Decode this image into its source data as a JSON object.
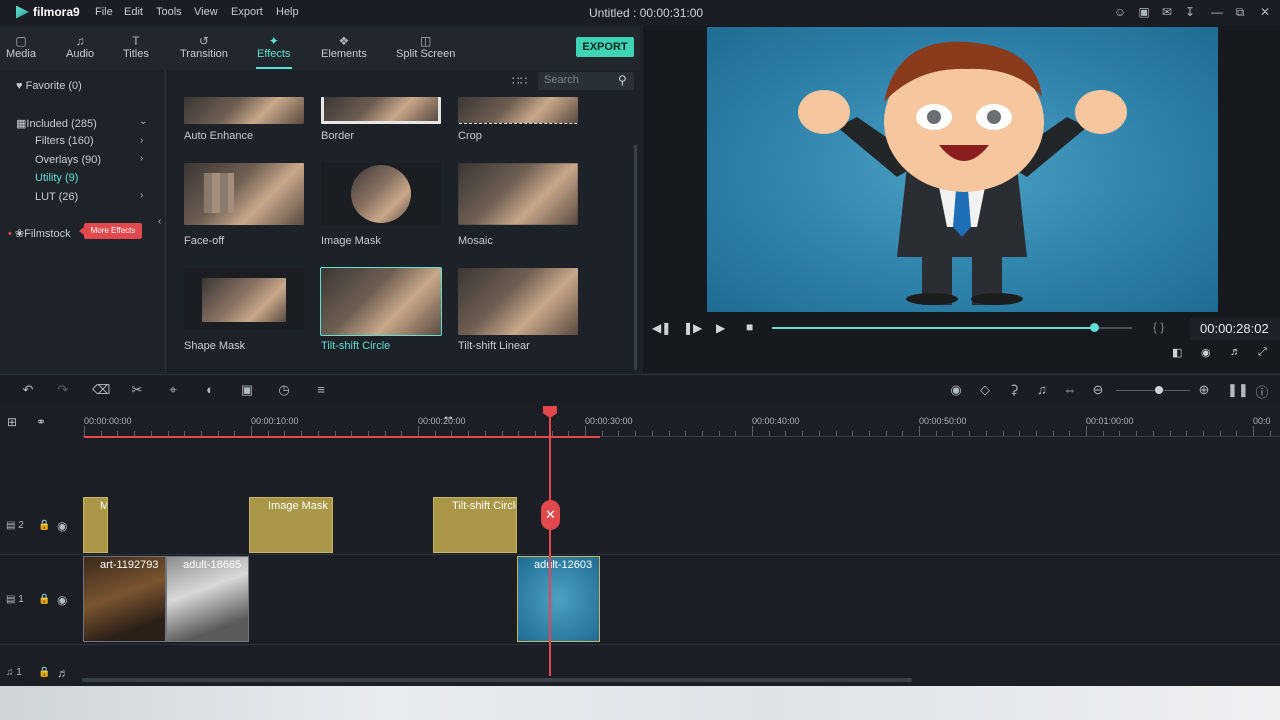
{
  "app": {
    "logo_text": "filmora9",
    "doc_title": "Untitled : 00:00:31:00",
    "menu": [
      "File",
      "Edit",
      "Tools",
      "View",
      "Export",
      "Help"
    ]
  },
  "tabs": [
    {
      "label": "Media",
      "icon": "folder-icon"
    },
    {
      "label": "Audio",
      "icon": "music-icon"
    },
    {
      "label": "Titles",
      "icon": "text-icon"
    },
    {
      "label": "Transition",
      "icon": "transition-icon"
    },
    {
      "label": "Effects",
      "icon": "effects-icon"
    },
    {
      "label": "Elements",
      "icon": "elements-icon"
    },
    {
      "label": "Split Screen",
      "icon": "split-screen-icon"
    }
  ],
  "export_label": "EXPORT",
  "sidebar": {
    "favorite": "Favorite (0)",
    "included": "Included (285)",
    "items": [
      {
        "label": "Filters (160)"
      },
      {
        "label": "Overlays (90)"
      },
      {
        "label": "Utility (9)"
      },
      {
        "label": "LUT (26)"
      }
    ],
    "filmstock": "Filmstock",
    "more_effects": "More Effects"
  },
  "search": {
    "placeholder": "Search"
  },
  "effects": [
    {
      "label": "Auto Enhance"
    },
    {
      "label": "Border"
    },
    {
      "label": "Crop"
    },
    {
      "label": "Face-off"
    },
    {
      "label": "Image Mask"
    },
    {
      "label": "Mosaic"
    },
    {
      "label": "Shape Mask"
    },
    {
      "label": "Tilt-shift Circle"
    },
    {
      "label": "Tilt-shift Linear"
    }
  ],
  "player": {
    "timecode": "00:00:28:02",
    "brackets": "{   }",
    "progress_fraction": 0.894
  },
  "timeline": {
    "ruler": [
      "00:00:00:00",
      "00:00:10:00",
      "00:00:20:00",
      "00:00:30:00",
      "00:00:40:00",
      "00:00:50:00",
      "00:01:00:00",
      "00:0"
    ],
    "tracks": [
      {
        "label": "2"
      },
      {
        "label": "1"
      },
      {
        "label": "1"
      }
    ],
    "effect_clips": [
      {
        "label": "M"
      },
      {
        "label": "Image Mask"
      },
      {
        "label": "Tilt-shift Circle"
      }
    ],
    "video_clips": [
      {
        "label": "art-1192793"
      },
      {
        "label": "adult-18665"
      },
      {
        "label": "adult-12603"
      }
    ]
  },
  "colors": {
    "accent": "#5fe0d0",
    "playhead": "#e2484c",
    "effect_clip": "#a99646"
  }
}
